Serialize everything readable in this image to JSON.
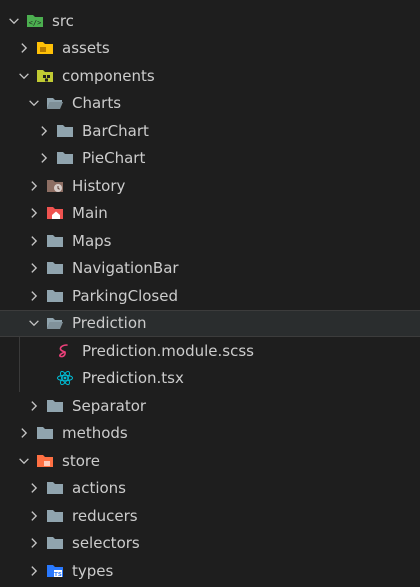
{
  "explorer": {
    "items": [
      {
        "label": "src",
        "indent": 0,
        "expanded": true,
        "icon": "src-folder-icon"
      },
      {
        "label": "assets",
        "indent": 1,
        "expanded": false,
        "icon": "assets-folder-icon"
      },
      {
        "label": "components",
        "indent": 1,
        "expanded": true,
        "icon": "components-folder-icon"
      },
      {
        "label": "Charts",
        "indent": 2,
        "expanded": true,
        "icon": "folder-open-icon"
      },
      {
        "label": "BarChart",
        "indent": 3,
        "expanded": false,
        "icon": "folder-icon"
      },
      {
        "label": "PieChart",
        "indent": 3,
        "expanded": false,
        "icon": "folder-icon"
      },
      {
        "label": "History",
        "indent": 2,
        "expanded": false,
        "icon": "history-folder-icon"
      },
      {
        "label": "Main",
        "indent": 2,
        "expanded": false,
        "icon": "home-folder-icon"
      },
      {
        "label": "Maps",
        "indent": 2,
        "expanded": false,
        "icon": "folder-icon"
      },
      {
        "label": "NavigationBar",
        "indent": 2,
        "expanded": false,
        "icon": "folder-icon"
      },
      {
        "label": "ParkingClosed",
        "indent": 2,
        "expanded": false,
        "icon": "folder-icon"
      },
      {
        "label": "Prediction",
        "indent": 2,
        "expanded": true,
        "icon": "folder-open-icon",
        "selected": true
      },
      {
        "label": "Prediction.module.scss",
        "indent": 3,
        "file": true,
        "icon": "sass-file-icon"
      },
      {
        "label": "Prediction.tsx",
        "indent": 3,
        "file": true,
        "icon": "react-file-icon"
      },
      {
        "label": "Separator",
        "indent": 2,
        "expanded": false,
        "icon": "folder-icon"
      },
      {
        "label": "methods",
        "indent": 1,
        "expanded": false,
        "icon": "folder-icon"
      },
      {
        "label": "store",
        "indent": 1,
        "expanded": true,
        "icon": "store-folder-icon"
      },
      {
        "label": "actions",
        "indent": 2,
        "expanded": false,
        "icon": "folder-icon"
      },
      {
        "label": "reducers",
        "indent": 2,
        "expanded": false,
        "icon": "folder-icon"
      },
      {
        "label": "selectors",
        "indent": 2,
        "expanded": false,
        "icon": "folder-icon"
      },
      {
        "label": "types",
        "indent": 2,
        "expanded": false,
        "icon": "typescript-folder-icon"
      }
    ]
  },
  "colors": {
    "background": "#1e1e1e",
    "selected": "#2a2d2e",
    "folder": "#90a4ae",
    "src": "#4caf50",
    "assets": "#ffc107",
    "components": "#c0ca33",
    "history": "#8d6e63",
    "home": "#ef5350",
    "sass": "#ec407a",
    "react": "#00bcd4",
    "store": "#ff7043",
    "typescript": "#2979ff"
  }
}
